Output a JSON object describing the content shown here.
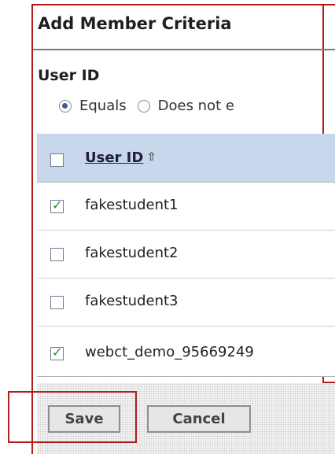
{
  "header": {
    "title": "Add Member Criteria"
  },
  "criteria": {
    "label": "User ID",
    "options": [
      {
        "label": "Equals",
        "selected": true
      },
      {
        "label": "Does not e",
        "selected": false
      }
    ]
  },
  "table": {
    "column_header": "User ID",
    "rows": [
      {
        "user_id": "fakestudent1",
        "checked": true
      },
      {
        "user_id": "fakestudent2",
        "checked": false
      },
      {
        "user_id": "fakestudent3",
        "checked": false
      },
      {
        "user_id": "webct_demo_95669249",
        "checked": true
      }
    ]
  },
  "actions": {
    "save_label": "Save",
    "cancel_label": "Cancel"
  },
  "colors": {
    "header_bg": "#c9d7ec",
    "annotation_red": "#b01e1e",
    "check_green": "#2f8a2f"
  }
}
